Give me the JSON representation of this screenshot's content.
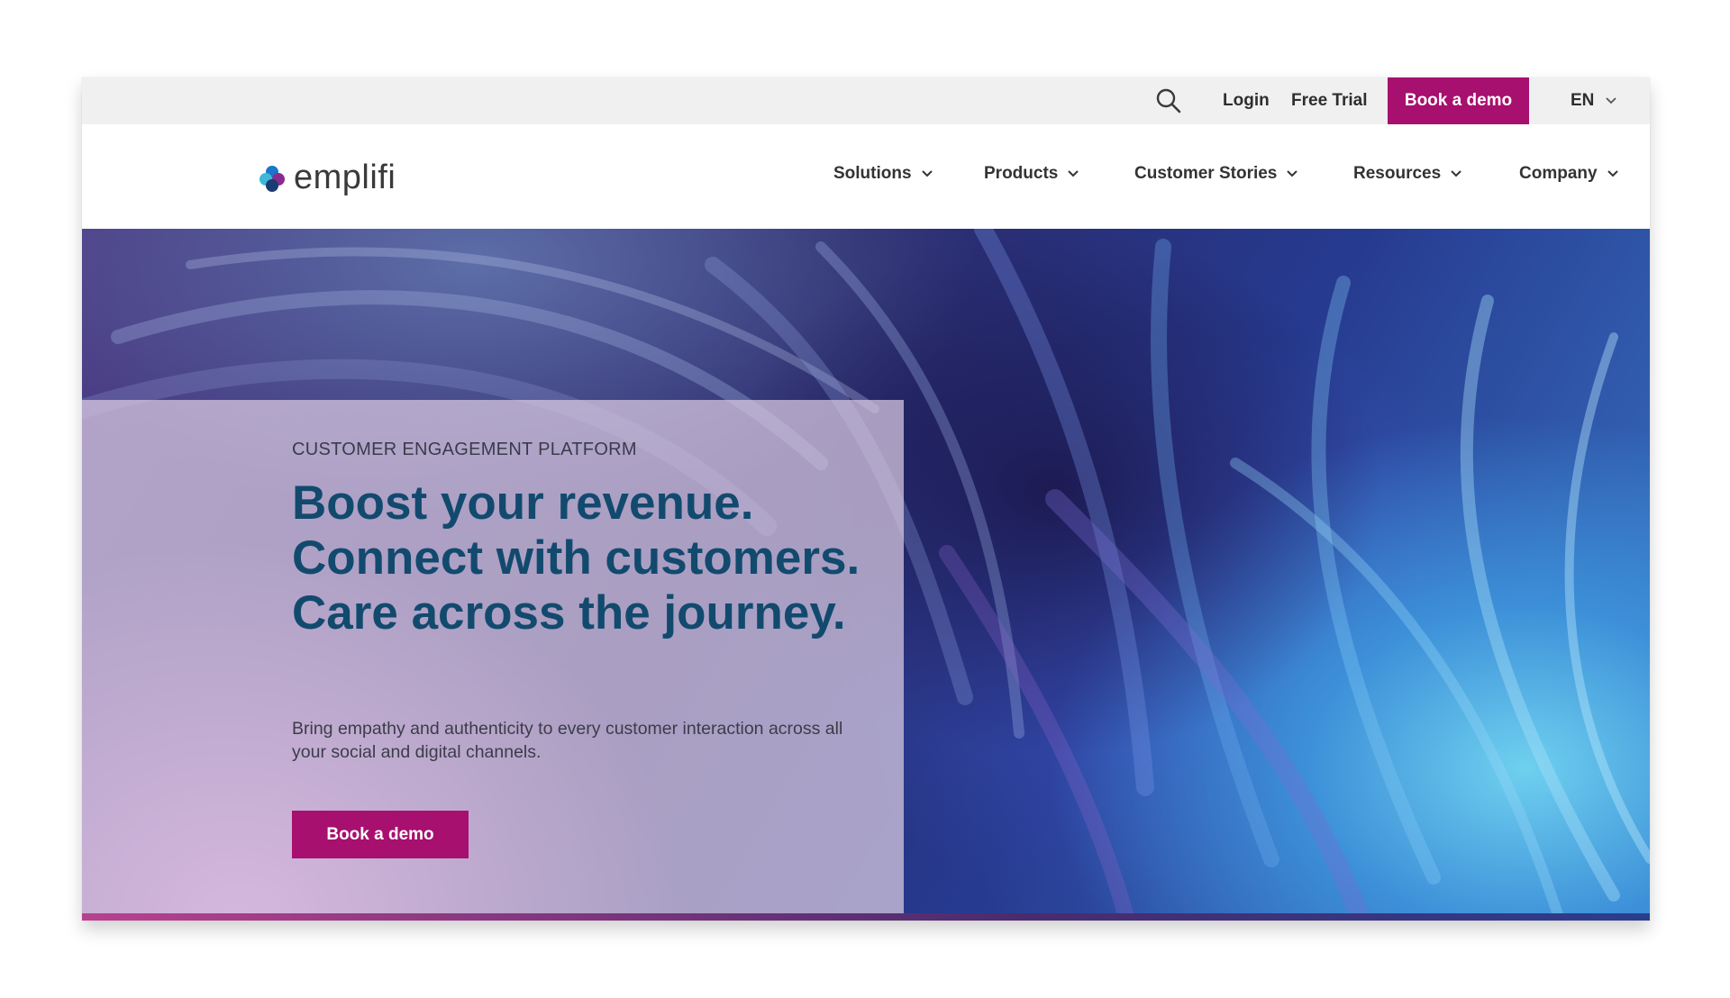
{
  "topbar": {
    "search_icon": "search-icon",
    "login_label": "Login",
    "free_trial_label": "Free Trial",
    "book_demo_label": "Book a demo",
    "language": "EN"
  },
  "brand": {
    "name": "emplifi",
    "accent": "#a7106e",
    "headline_color": "#124a6e"
  },
  "nav": {
    "items": [
      {
        "label": "Solutions"
      },
      {
        "label": "Products"
      },
      {
        "label": "Customer Stories"
      },
      {
        "label": "Resources"
      },
      {
        "label": "Company"
      }
    ]
  },
  "hero": {
    "eyebrow": "CUSTOMER ENGAGEMENT PLATFORM",
    "headline": "Boost your revenue. Connect with customers. Care across the journey.",
    "subtext": "Bring empathy and authenticity to every customer interaction across all your social and digital channels.",
    "cta_label": "Book a demo"
  }
}
